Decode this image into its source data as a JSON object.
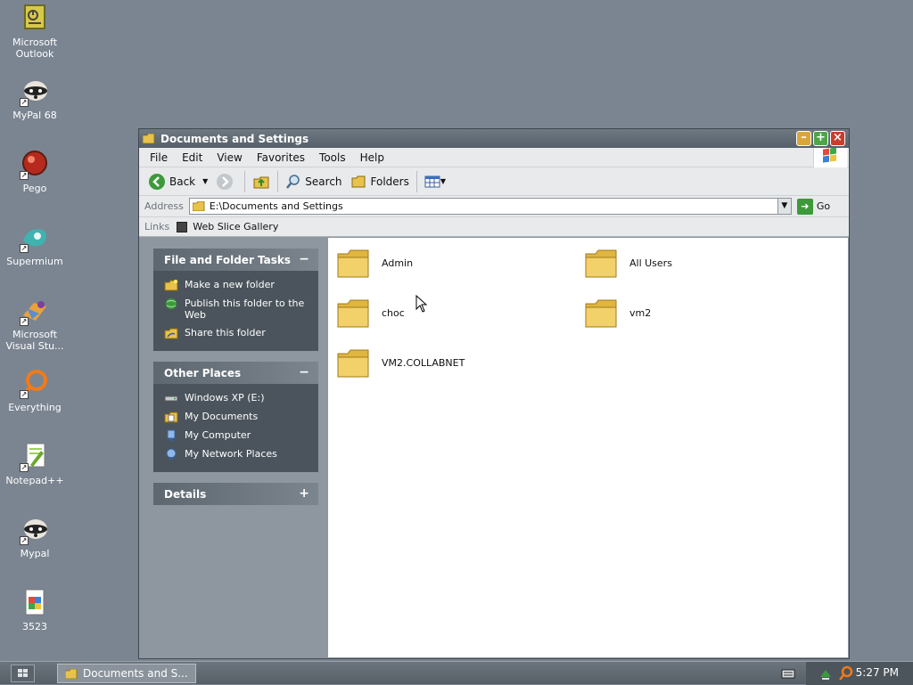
{
  "desktop": {
    "icons": [
      {
        "label": "Microsoft Outlook",
        "icon": "outlook-icon"
      },
      {
        "label": "MyPal 68",
        "icon": "raccoon-icon"
      },
      {
        "label": "Pego",
        "icon": "pego-icon"
      },
      {
        "label": "Supermium",
        "icon": "supermium-icon"
      },
      {
        "label": "Microsoft Visual Stu...",
        "icon": "visual-studio-icon"
      },
      {
        "label": "Everything",
        "icon": "everything-icon"
      },
      {
        "label": "Notepad++",
        "icon": "notepadpp-icon"
      },
      {
        "label": "Mypal",
        "icon": "raccoon-icon"
      },
      {
        "label": "3523",
        "icon": "document-icon"
      }
    ]
  },
  "window": {
    "title": "Documents and Settings",
    "menu": [
      "File",
      "Edit",
      "View",
      "Favorites",
      "Tools",
      "Help"
    ],
    "toolbar": {
      "back": "Back",
      "search": "Search",
      "folders": "Folders"
    },
    "address": {
      "label": "Address",
      "value": "E:\\Documents and Settings",
      "go": "Go"
    },
    "links": {
      "label": "Links",
      "item": "Web Slice Gallery"
    }
  },
  "tasks": {
    "file_folder": {
      "title": "File and Folder Tasks",
      "items": [
        "Make a new folder",
        "Publish this folder to the Web",
        "Share this folder"
      ]
    },
    "other_places": {
      "title": "Other Places",
      "items": [
        "Windows XP (E:)",
        "My Documents",
        "My Computer",
        "My Network Places"
      ]
    },
    "details": {
      "title": "Details"
    }
  },
  "folders": [
    "Admin",
    "All Users",
    "choc",
    "vm2",
    "VM2.COLLABNET"
  ],
  "taskbar": {
    "task": "Documents and S...",
    "clock": "5:27 PM"
  },
  "colors": {
    "folder": "#e8c24a",
    "accent_green": "#3c9a3a",
    "close_red": "#c93d2d"
  }
}
